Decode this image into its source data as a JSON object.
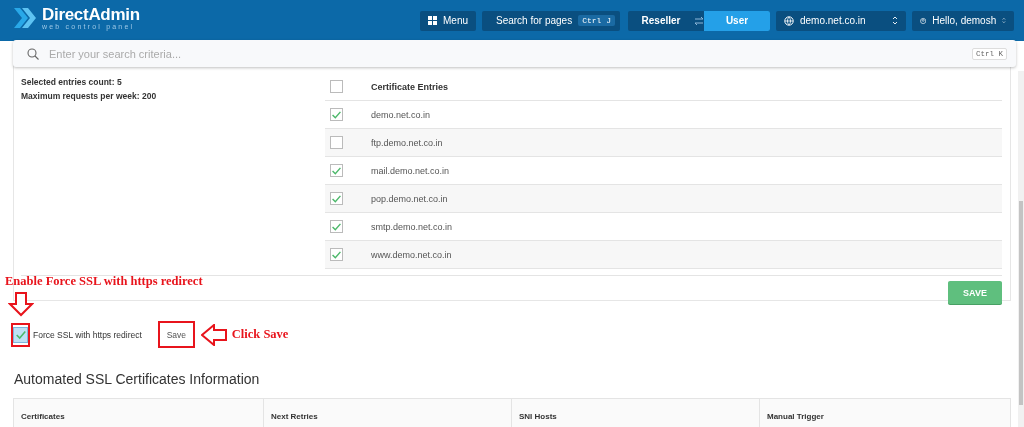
{
  "header": {
    "logo_title": "DirectAdmin",
    "logo_subtitle": "web control panel",
    "menu": "Menu",
    "page_search": {
      "label": "Search for pages",
      "shortcut": "Ctrl J"
    },
    "level_switch": [
      {
        "label": "Reseller",
        "selected": false
      },
      {
        "label": "User",
        "selected": true
      }
    ],
    "domain": "demo.net.co.in",
    "user": "Hello, demosh"
  },
  "search": {
    "placeholder": "Enter your search criteria...",
    "shortcut": "Ctrl K"
  },
  "info": [
    "Selected entries count: 5",
    "Maximum requests per week: 200"
  ],
  "entries_table": {
    "header": "Certificate Entries",
    "all_checked": false,
    "rows": [
      {
        "name": "demo.net.co.in",
        "checked": true
      },
      {
        "name": "ftp.demo.net.co.in",
        "checked": false
      },
      {
        "name": "mail.demo.net.co.in",
        "checked": true
      },
      {
        "name": "pop.demo.net.co.in",
        "checked": true
      },
      {
        "name": "smtp.demo.net.co.in",
        "checked": true
      },
      {
        "name": "www.demo.net.co.in",
        "checked": true
      }
    ]
  },
  "save_button": "SAVE",
  "force_ssl": {
    "label": "Force SSL with https redirect",
    "checked": true,
    "button": "Save"
  },
  "annotations": [
    {
      "text": "Enable Force SSL with https redirect"
    },
    {
      "text": "Click Save"
    }
  ],
  "info_section": {
    "title": "Automated SSL Certificates Information",
    "columns": [
      "Certificates",
      "Next Retries",
      "SNI Hosts",
      "Manual Trigger"
    ]
  }
}
